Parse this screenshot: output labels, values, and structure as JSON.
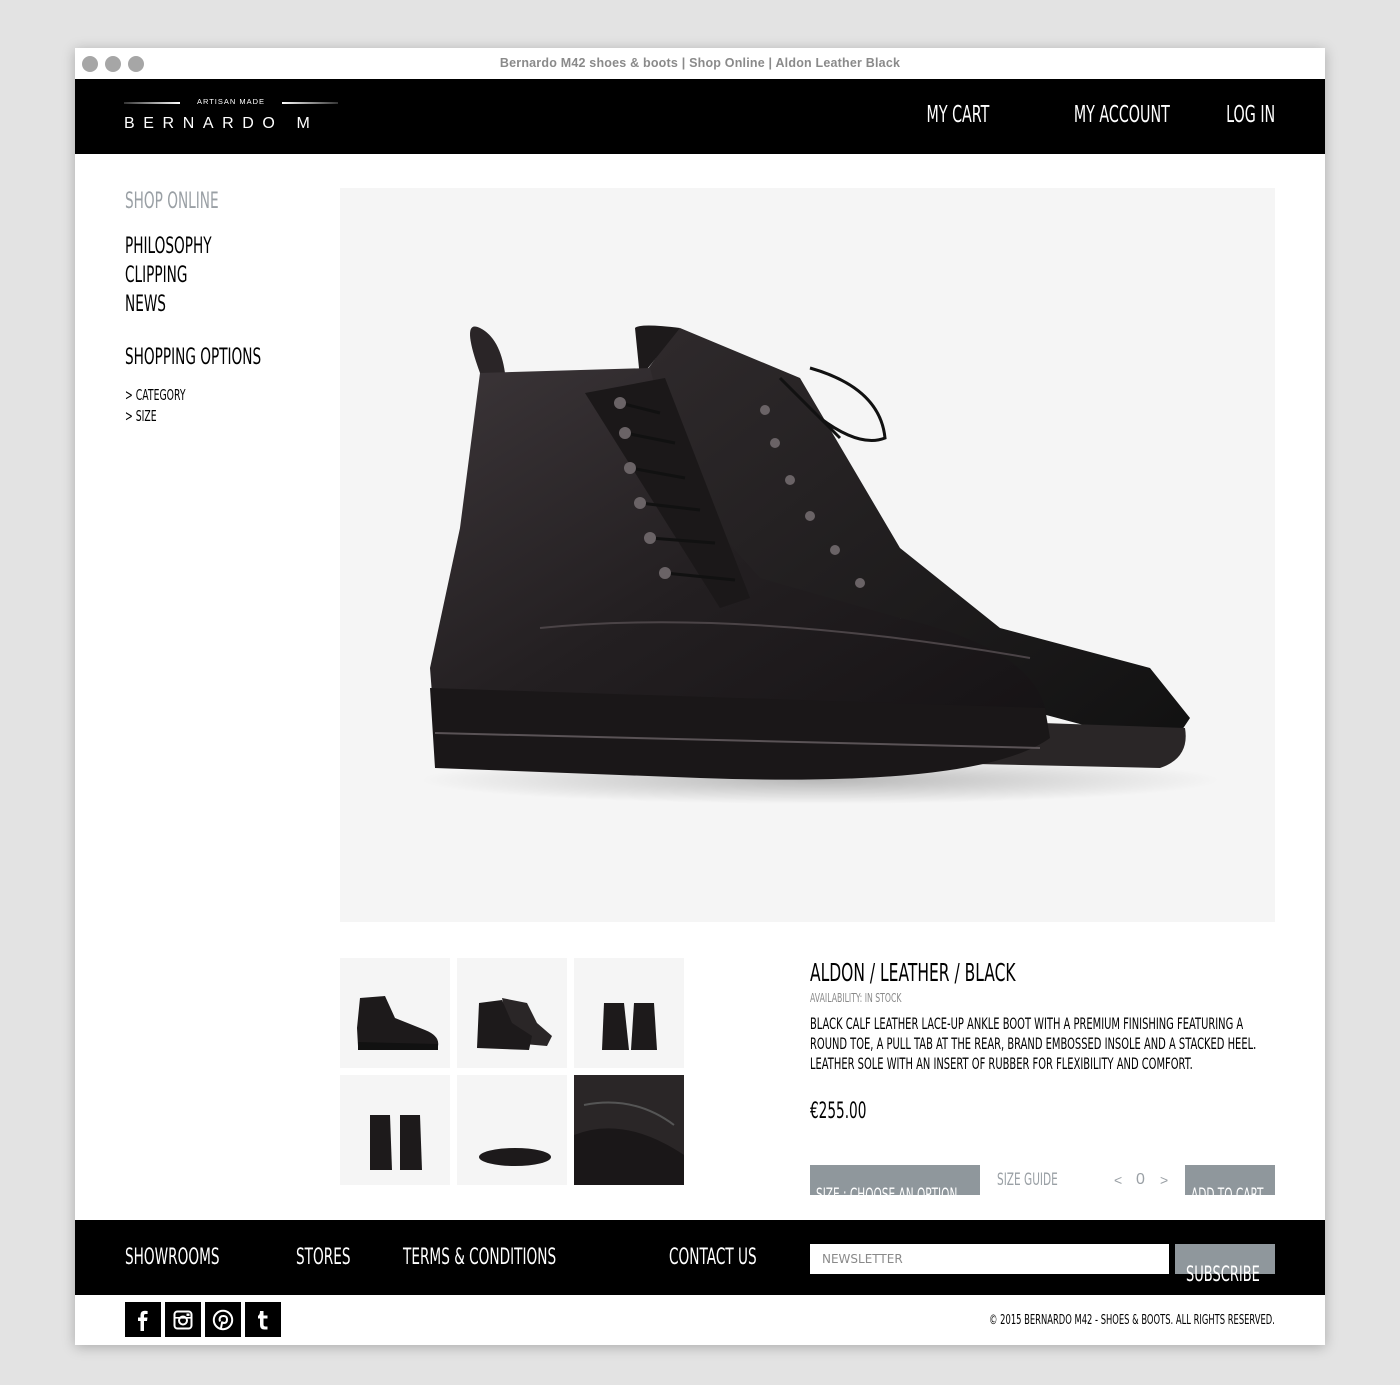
{
  "window": {
    "title": "Bernardo M42 shoes & boots | Shop Online | Aldon Leather Black"
  },
  "header": {
    "logo_tagline": "ARTISAN  MADE",
    "logo_name": "BERNARDO M",
    "nav": {
      "cart": "MY CART",
      "account": "MY ACCOUNT",
      "login": "LOG IN"
    }
  },
  "sidebar": {
    "title": "SHOP ONLINE",
    "links": [
      "PHILOSOPHY",
      "CLIPPING",
      "NEWS"
    ],
    "options_title": "SHOPPING OPTIONS",
    "options": [
      "> CATEGORY",
      "> SIZE"
    ]
  },
  "product": {
    "title": "ALDON / LEATHER / BLACK",
    "availability": "AVAILABILITY: IN STOCK",
    "description": "BLACK CALF LEATHER LACE-UP ANKLE BOOT WITH A PREMIUM FINISHING FEATURING A ROUND TOE, A PULL TAB AT THE REAR, BRAND EMBOSSED INSOLE AND A STACKED HEEL. LEATHER SOLE WITH AN INSERT OF RUBBER FOR FLEXIBILITY AND COMFORT.",
    "price": "€255.00",
    "size_button": "SIZE :   CHOOSE AN OPTION",
    "size_guide": "SIZE GUIDE",
    "qty_decrease": "<",
    "qty_value": "0",
    "qty_increase": ">",
    "add_to_cart": "ADD TO CART",
    "thumbnails": [
      "side-view",
      "three-quarter-view",
      "front-pair",
      "back-pair",
      "sole-view",
      "close-up"
    ]
  },
  "footer": {
    "links": [
      "SHOWROOMS",
      "STORES",
      "TERMS & CONDITIONS",
      "CONTACT US"
    ],
    "newsletter_placeholder": "NEWSLETTER",
    "subscribe": "SUBSCRIBE",
    "socials": [
      "facebook-icon",
      "instagram-icon",
      "pinterest-icon",
      "tumblr-icon"
    ],
    "copyright": "© 2015 BERNARDO M42 - SHOES & BOOTS. ALL RIGHTS RESERVED."
  },
  "colors": {
    "header_bg": "#000000",
    "accent_gray": "#8f979c",
    "muted_text": "#9aa0a5",
    "image_bg": "#f5f5f5"
  }
}
